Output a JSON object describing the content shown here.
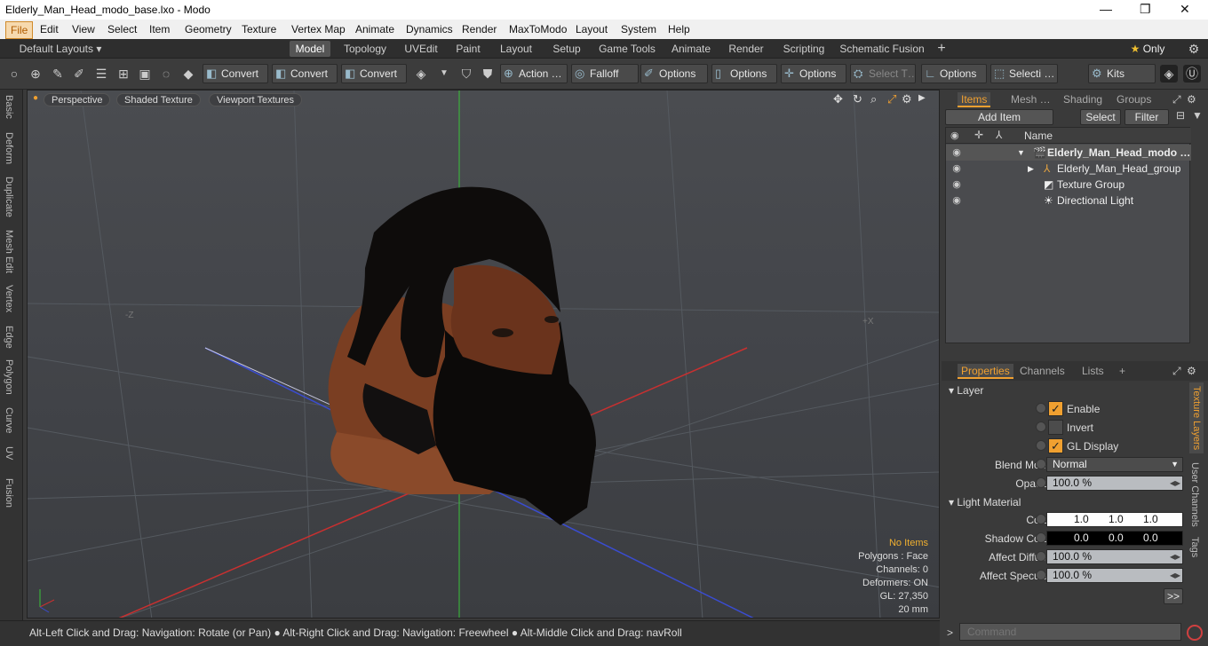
{
  "window": {
    "title": "Elderly_Man_Head_modo_base.lxo - Modo",
    "minimize": "—",
    "maximize": "❐",
    "close": "✕"
  },
  "menu": [
    "File",
    "Edit",
    "View",
    "Select",
    "Item",
    "Geometry",
    "Texture",
    "Vertex Map",
    "Animate",
    "Dynamics",
    "Render",
    "MaxToModo",
    "Layout",
    "System",
    "Help"
  ],
  "layouts": {
    "label": "Default Layouts ▾"
  },
  "tabs": [
    "Model",
    "Topology",
    "UVEdit",
    "Paint",
    "Layout",
    "Setup",
    "Game Tools",
    "Animate",
    "Render",
    "Scripting",
    "Schematic Fusion",
    "+"
  ],
  "tabs_active": "Model",
  "only": {
    "star": "★",
    "label": "Only"
  },
  "toolbar": {
    "convert1": "Convert",
    "convert2": "Convert",
    "convert3": "Convert",
    "action": "Action …",
    "falloff": "Falloff",
    "options1": "Options",
    "options2": "Options",
    "options3": "Options",
    "select_t": "Select T…",
    "options4": "Options",
    "selecti": "Selecti …",
    "kits": "Kits"
  },
  "left_tabs": [
    "Basic",
    "Deform",
    "Duplicate",
    "Mesh Edit",
    "Vertex",
    "Edge",
    "Polygon",
    "Curve",
    "UV",
    "Fusion"
  ],
  "viewport": {
    "view_mode": "Perspective",
    "shading": "Shaded Texture",
    "textures": "Viewport Textures",
    "axis_neg_z": "-Z",
    "axis_pos_x": "+X",
    "info": {
      "no_items": "No Items",
      "polygons": "Polygons : Face",
      "channels": "Channels: 0",
      "deformers": "Deformers: ON",
      "gl": "GL: 27,350",
      "scale": "20 mm"
    }
  },
  "status": "Alt-Left Click and Drag: Navigation: Rotate (or Pan) ● Alt-Right Click and Drag: Navigation: Freewheel ● Alt-Middle Click and Drag: navRoll",
  "items_panel": {
    "tabs": [
      "Items",
      "Mesh …",
      "Shading",
      "Groups"
    ],
    "add_item": "Add Item",
    "select": "Select",
    "filter": "Filter",
    "col_name": "Name",
    "rows": [
      "Elderly_Man_Head_modo …",
      "Elderly_Man_Head_group",
      "Texture Group",
      "Directional Light"
    ]
  },
  "properties_panel": {
    "tabs": [
      "Properties",
      "Channels",
      "Lists",
      "+"
    ],
    "side_tabs": [
      "Texture Layers",
      "User Channels",
      "Tags"
    ],
    "layer_section": "Layer",
    "enable": "Enable",
    "invert": "Invert",
    "gl_display": "GL Display",
    "blend_mode_label": "Blend Mode",
    "blend_mode": "Normal",
    "opacity_label": "Opacity",
    "opacity": "100.0 %",
    "light_material": "Light Material",
    "color_label": "Color",
    "color": [
      "1.0",
      "1.0",
      "1.0"
    ],
    "shadow_label": "Shadow Color",
    "shadow": [
      "0.0",
      "0.0",
      "0.0"
    ],
    "diffuse_label": "Affect Diffuse",
    "diffuse": "100.0 %",
    "specular_label": "Affect Specular",
    "specular": "100.0 %",
    "more": ">>"
  },
  "command": {
    "placeholder": "Command"
  }
}
